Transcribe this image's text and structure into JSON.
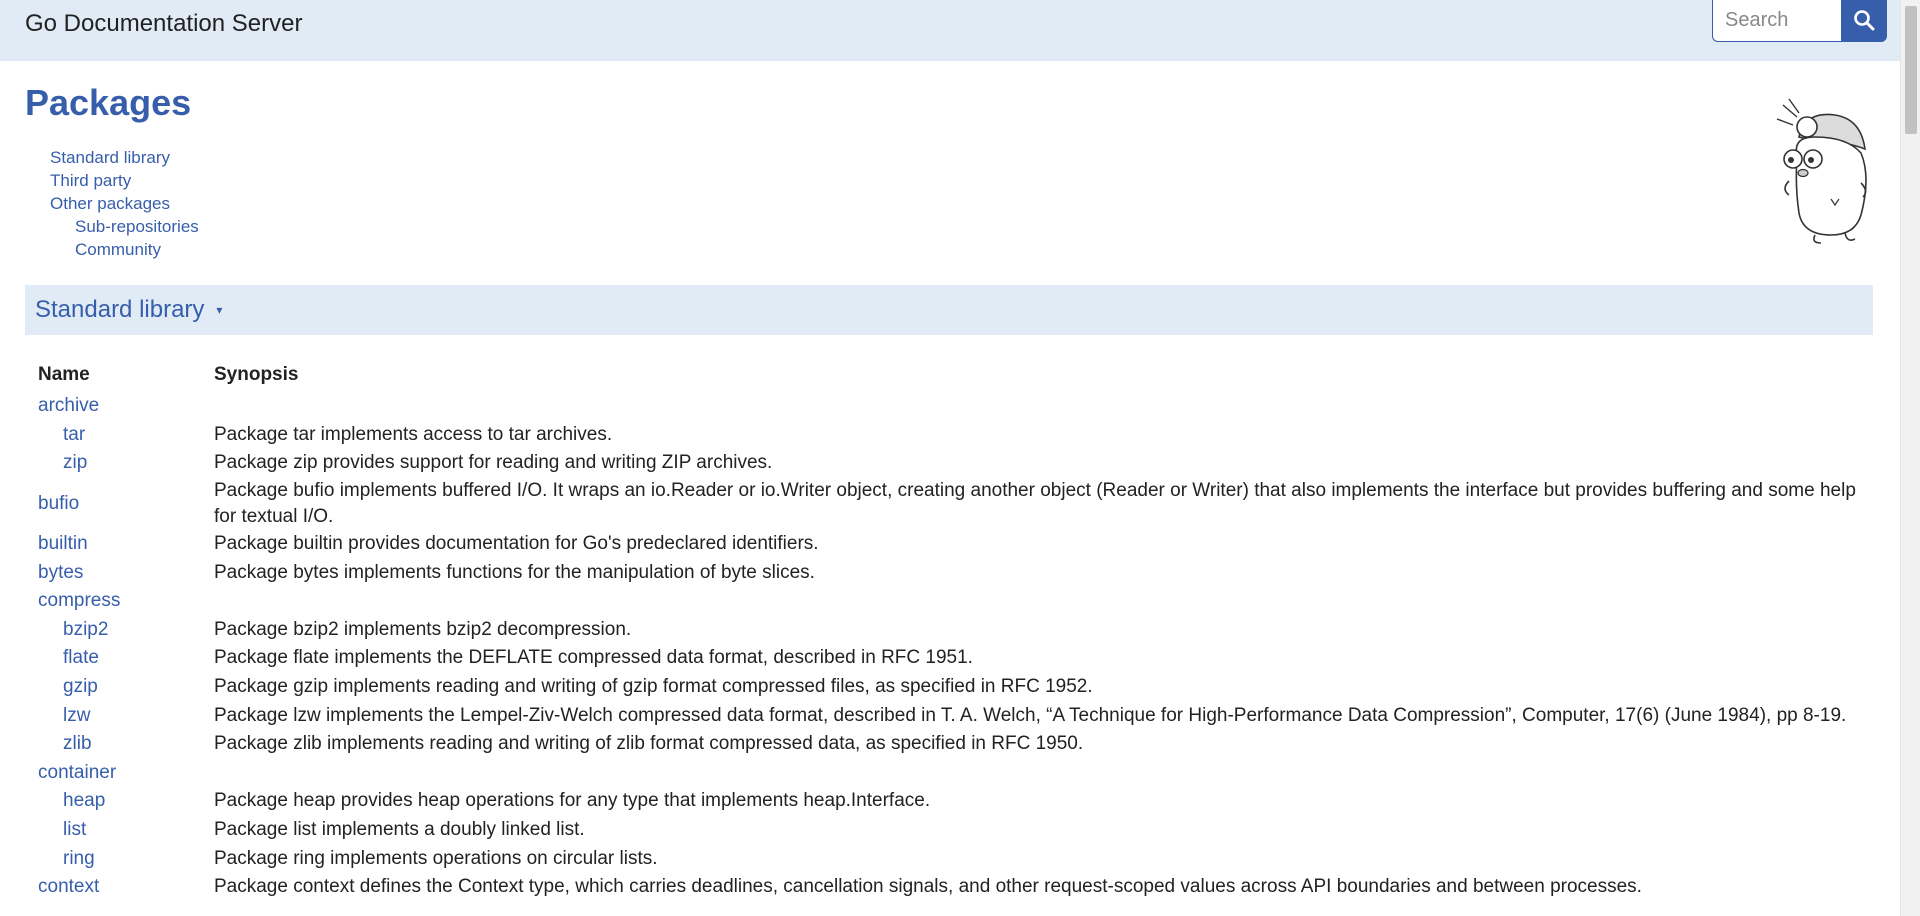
{
  "header": {
    "site_title": "Go Documentation Server",
    "search_placeholder": "Search"
  },
  "page": {
    "title": "Packages",
    "toc": [
      {
        "label": "Standard library",
        "level": 1
      },
      {
        "label": "Third party",
        "level": 1
      },
      {
        "label": "Other packages",
        "level": 1
      },
      {
        "label": "Sub-repositories",
        "level": 2
      },
      {
        "label": "Community",
        "level": 2
      }
    ]
  },
  "section": {
    "title": "Standard library",
    "caret": "▾"
  },
  "table": {
    "headers": {
      "name": "Name",
      "synopsis": "Synopsis"
    },
    "rows": [
      {
        "name": "archive",
        "child": false,
        "synopsis": ""
      },
      {
        "name": "tar",
        "child": true,
        "synopsis": "Package tar implements access to tar archives."
      },
      {
        "name": "zip",
        "child": true,
        "synopsis": "Package zip provides support for reading and writing ZIP archives."
      },
      {
        "name": "bufio",
        "child": false,
        "synopsis": "Package bufio implements buffered I/O. It wraps an io.Reader or io.Writer object, creating another object (Reader or Writer) that also implements the interface but provides buffering and some help for textual I/O."
      },
      {
        "name": "builtin",
        "child": false,
        "synopsis": "Package builtin provides documentation for Go's predeclared identifiers."
      },
      {
        "name": "bytes",
        "child": false,
        "synopsis": "Package bytes implements functions for the manipulation of byte slices."
      },
      {
        "name": "compress",
        "child": false,
        "synopsis": ""
      },
      {
        "name": "bzip2",
        "child": true,
        "synopsis": "Package bzip2 implements bzip2 decompression."
      },
      {
        "name": "flate",
        "child": true,
        "synopsis": "Package flate implements the DEFLATE compressed data format, described in RFC 1951."
      },
      {
        "name": "gzip",
        "child": true,
        "synopsis": "Package gzip implements reading and writing of gzip format compressed files, as specified in RFC 1952."
      },
      {
        "name": "lzw",
        "child": true,
        "synopsis": "Package lzw implements the Lempel-Ziv-Welch compressed data format, described in T. A. Welch, “A Technique for High-Performance Data Compression”, Computer, 17(6) (June 1984), pp 8-19."
      },
      {
        "name": "zlib",
        "child": true,
        "synopsis": "Package zlib implements reading and writing of zlib format compressed data, as specified in RFC 1950."
      },
      {
        "name": "container",
        "child": false,
        "synopsis": ""
      },
      {
        "name": "heap",
        "child": true,
        "synopsis": "Package heap provides heap operations for any type that implements heap.Interface."
      },
      {
        "name": "list",
        "child": true,
        "synopsis": "Package list implements a doubly linked list."
      },
      {
        "name": "ring",
        "child": true,
        "synopsis": "Package ring implements operations on circular lists."
      },
      {
        "name": "context",
        "child": false,
        "synopsis": "Package context defines the Context type, which carries deadlines, cancellation signals, and other request-scoped values across API boundaries and between processes."
      }
    ]
  },
  "colors": {
    "accent": "#375eab",
    "header_bg": "#e0ebf5",
    "text": "#222222"
  },
  "icons": [
    "search-icon",
    "gopher-logo"
  ]
}
